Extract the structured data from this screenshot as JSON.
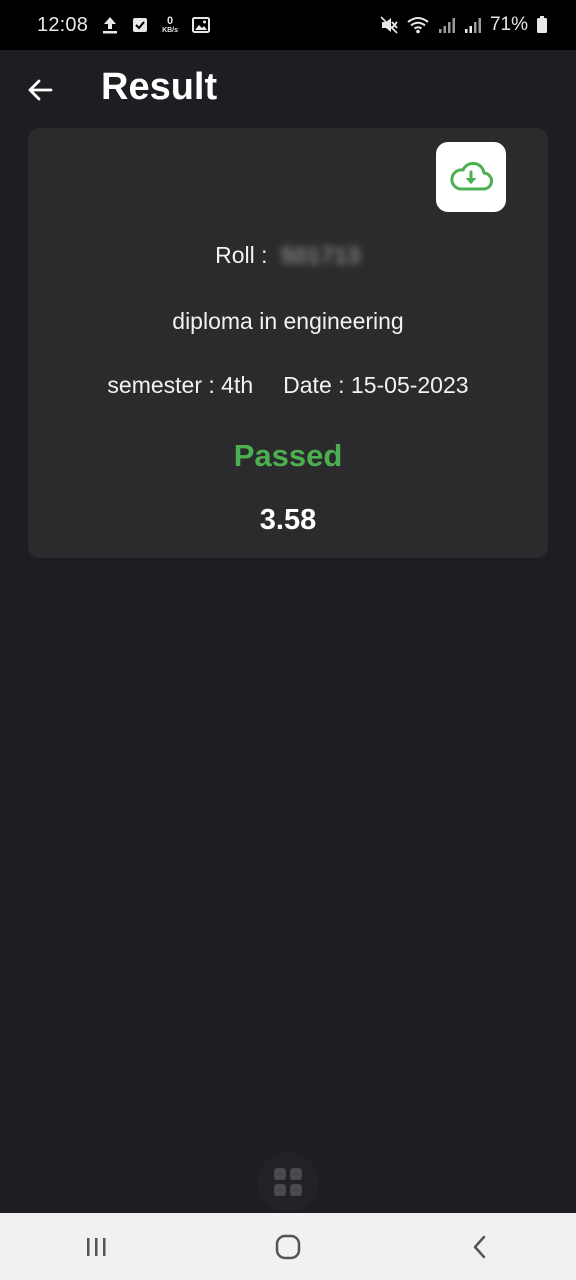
{
  "status_bar": {
    "time": "12:08",
    "data_speed_value": "0",
    "data_speed_unit": "KB/s",
    "battery": "71%",
    "icons": [
      "upload-icon",
      "checkbox-icon",
      "image-icon",
      "mute-icon",
      "wifi-icon",
      "signal-icon",
      "battery-icon"
    ]
  },
  "header": {
    "title": "Result"
  },
  "result": {
    "roll_label": "Roll :",
    "roll_value": "501713",
    "program": "diploma in engineering",
    "semester": "semester : 4th",
    "date": "Date : 15-05-2023",
    "status": "Passed",
    "gpa": "3.58"
  },
  "colors": {
    "background": "#1e1d22",
    "card": "#2b2b2d",
    "success": "#4caf50"
  }
}
